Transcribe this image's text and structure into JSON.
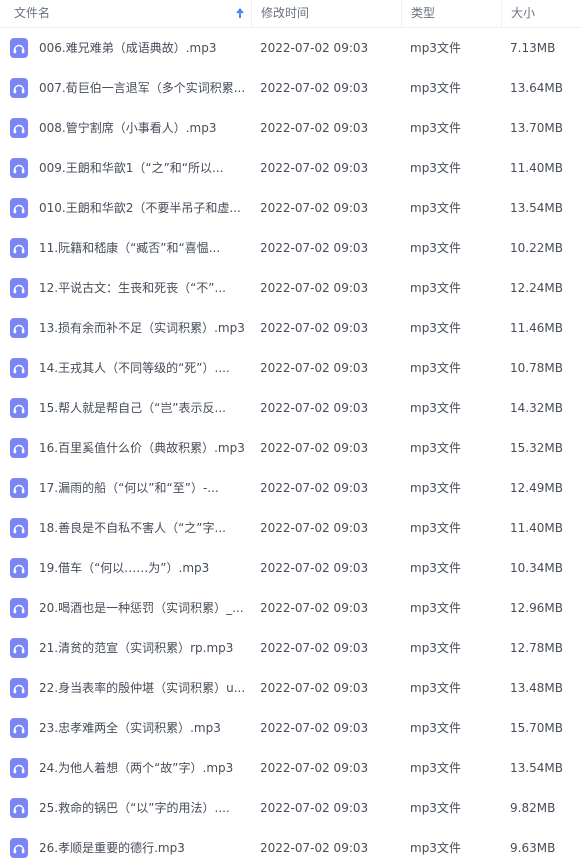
{
  "header": {
    "name_label": "文件名",
    "time_label": "修改时间",
    "type_label": "类型",
    "size_label": "大小"
  },
  "colors": {
    "icon_bg": "#7a86f5",
    "sort_arrow": "#3b8cff"
  },
  "files": [
    {
      "name": "006.难兄难弟（成语典故）.mp3",
      "time": "2022-07-02 09:03",
      "type": "mp3文件",
      "size": "7.13MB"
    },
    {
      "name": "007.荀巨伯一言退军（多个实词积累...",
      "time": "2022-07-02 09:03",
      "type": "mp3文件",
      "size": "13.64MB"
    },
    {
      "name": "008.管宁割席（小事看人）.mp3",
      "time": "2022-07-02 09:03",
      "type": "mp3文件",
      "size": "13.70MB"
    },
    {
      "name": "009.王朗和华歆1（“之”和“所以...",
      "time": "2022-07-02 09:03",
      "type": "mp3文件",
      "size": "11.40MB"
    },
    {
      "name": "010.王朗和华歆2（不要半吊子和虚...",
      "time": "2022-07-02 09:03",
      "type": "mp3文件",
      "size": "13.54MB"
    },
    {
      "name": "11.阮籍和嵇康（“臧否”和“喜愠...",
      "time": "2022-07-02 09:03",
      "type": "mp3文件",
      "size": "10.22MB"
    },
    {
      "name": "12.平说古文：生丧和死丧（“不”...",
      "time": "2022-07-02 09:03",
      "type": "mp3文件",
      "size": "12.24MB"
    },
    {
      "name": "13.损有余而补不足（实词积累）.mp3",
      "time": "2022-07-02 09:03",
      "type": "mp3文件",
      "size": "11.46MB"
    },
    {
      "name": "14.王戎其人（不同等级的“死”）....",
      "time": "2022-07-02 09:03",
      "type": "mp3文件",
      "size": "10.78MB"
    },
    {
      "name": "15.帮人就是帮自己（“岂”表示反...",
      "time": "2022-07-02 09:03",
      "type": "mp3文件",
      "size": "14.32MB"
    },
    {
      "name": "16.百里奚值什么价（典故积累）.mp3",
      "time": "2022-07-02 09:03",
      "type": "mp3文件",
      "size": "15.32MB"
    },
    {
      "name": "17.漏雨的船（“何以”和“至”）-...",
      "time": "2022-07-02 09:03",
      "type": "mp3文件",
      "size": "12.49MB"
    },
    {
      "name": "18.善良是不自私不害人（“之”字...",
      "time": "2022-07-02 09:03",
      "type": "mp3文件",
      "size": "11.40MB"
    },
    {
      "name": "19.借车（“何以……为”）.mp3",
      "time": "2022-07-02 09:03",
      "type": "mp3文件",
      "size": "10.34MB"
    },
    {
      "name": "20.喝酒也是一种惩罚（实词积累）_...",
      "time": "2022-07-02 09:03",
      "type": "mp3文件",
      "size": "12.96MB"
    },
    {
      "name": "21.清贫的范宣（实词积累）rp.mp3",
      "time": "2022-07-02 09:03",
      "type": "mp3文件",
      "size": "12.78MB"
    },
    {
      "name": "22.身当表率的殷仲堪（实词积累）u...",
      "time": "2022-07-02 09:03",
      "type": "mp3文件",
      "size": "13.48MB"
    },
    {
      "name": "23.忠孝难两全（实词积累）.mp3",
      "time": "2022-07-02 09:03",
      "type": "mp3文件",
      "size": "15.70MB"
    },
    {
      "name": "24.为他人着想（两个“故”字）.mp3",
      "time": "2022-07-02 09:03",
      "type": "mp3文件",
      "size": "13.54MB"
    },
    {
      "name": "25.救命的锅巴（“以”字的用法）....",
      "time": "2022-07-02 09:03",
      "type": "mp3文件",
      "size": "9.82MB"
    },
    {
      "name": "26.孝顺是重要的德行.mp3",
      "time": "2022-07-02 09:03",
      "type": "mp3文件",
      "size": "9.63MB"
    }
  ]
}
